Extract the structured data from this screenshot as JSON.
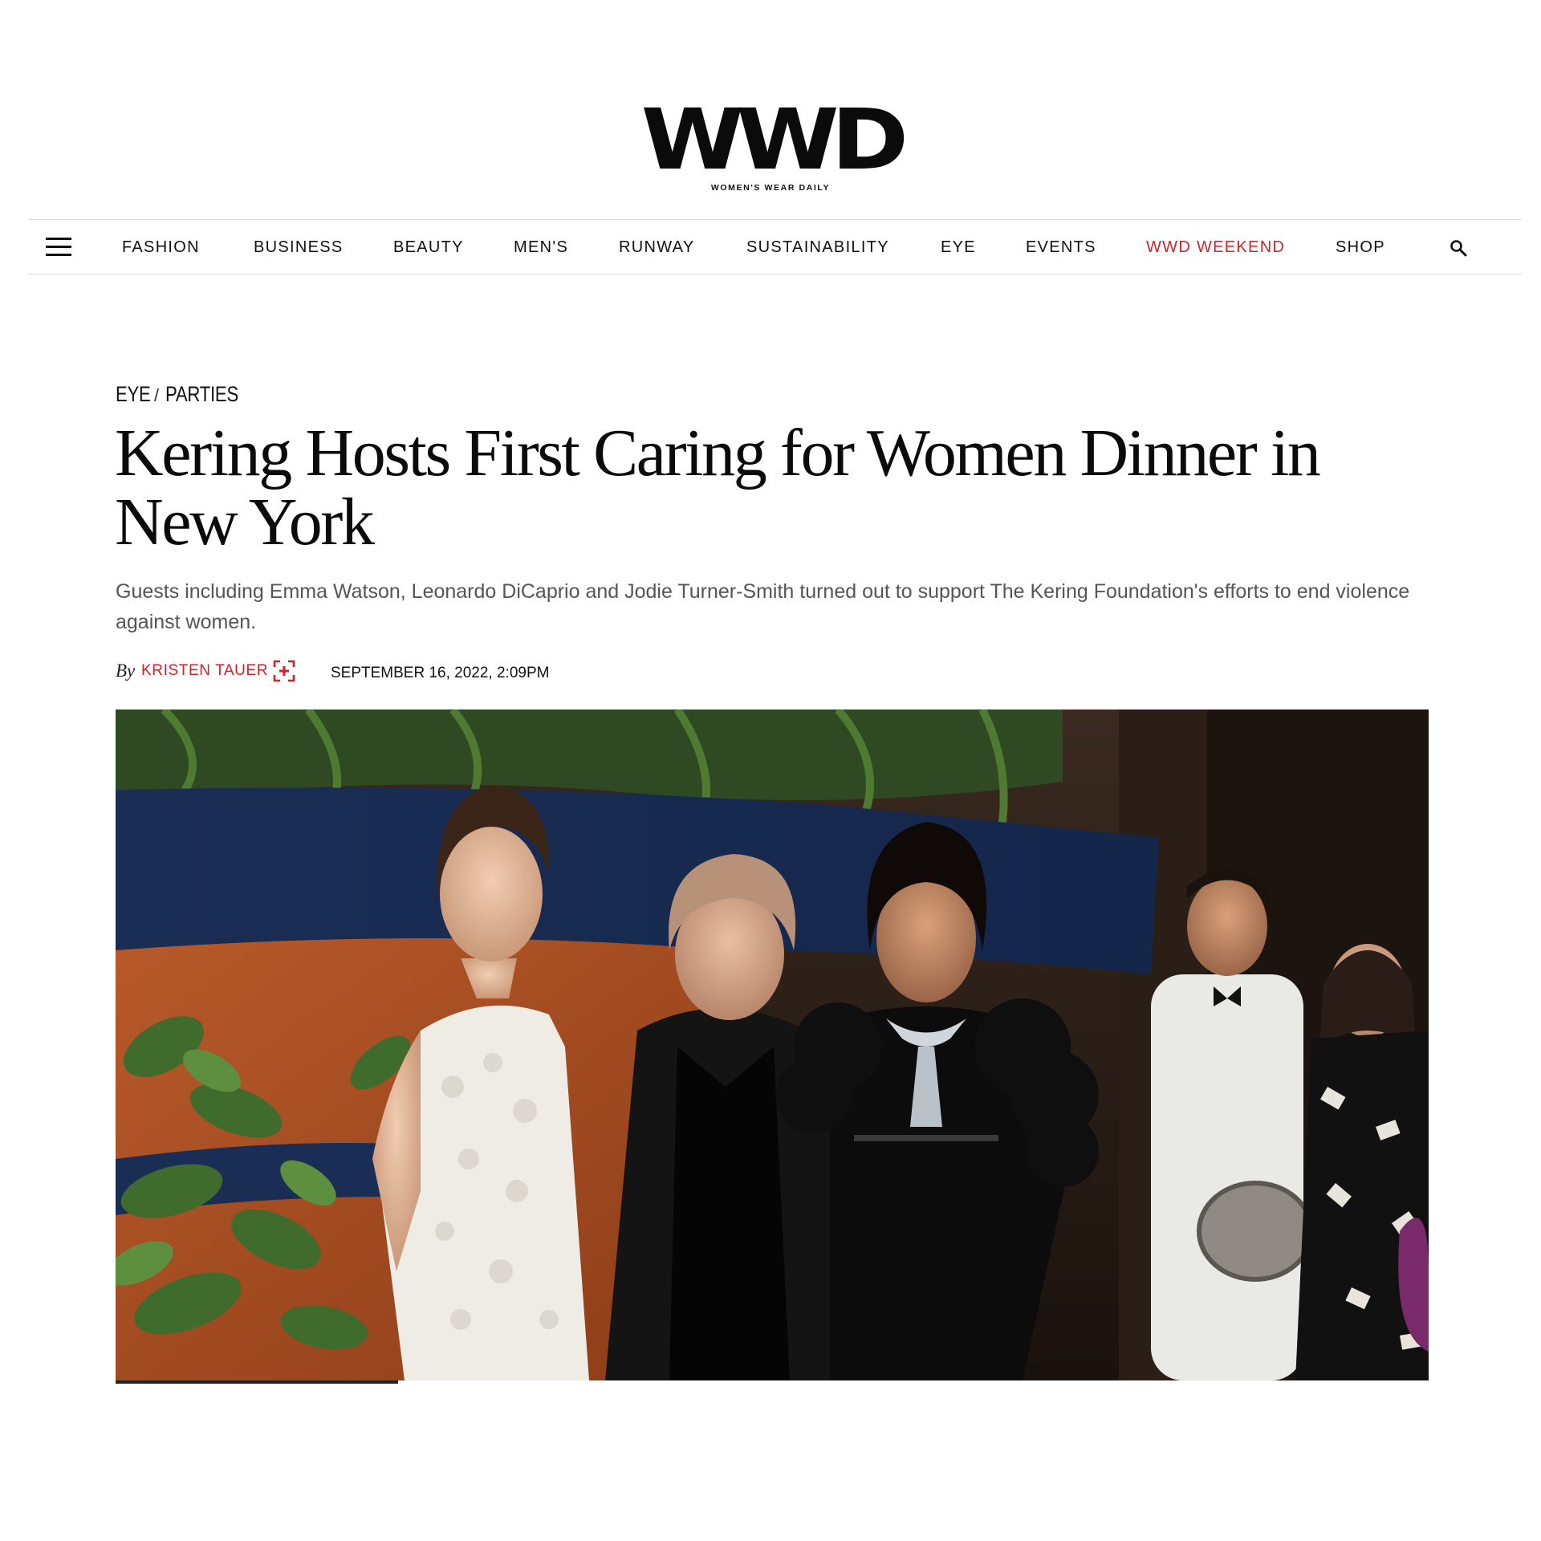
{
  "masthead": {
    "logo_word": "WWD",
    "logo_tagline": "WOMEN'S WEAR DAILY"
  },
  "nav": {
    "menu_icon": "hamburger-menu-icon",
    "items": [
      {
        "label": "FASHION"
      },
      {
        "label": "BUSINESS"
      },
      {
        "label": "BEAUTY"
      },
      {
        "label": "MEN'S"
      },
      {
        "label": "RUNWAY"
      },
      {
        "label": "SUSTAINABILITY"
      },
      {
        "label": "EYE"
      },
      {
        "label": "EVENTS"
      },
      {
        "label": "WWD WEEKEND",
        "color": "#d3222a"
      },
      {
        "label": "SHOP"
      }
    ],
    "search_icon": "search-icon"
  },
  "article": {
    "breadcrumb": [
      "EYE",
      "PARTIES"
    ],
    "breadcrumb_separator": "/",
    "headline": "Kering Hosts First Caring for Women Dinner in New York",
    "dek": "Guests including Emma Watson, Leonardo DiCaprio and Jodie Turner-Smith turned out to support The Kering Foundation's efforts to end violence against women.",
    "byline_prefix": "By",
    "author": "KRISTEN TAUER",
    "follow_icon": "follow-author-plus-icon",
    "date": "SEPTEMBER 16, 2022, 2:09PM",
    "image_progress_fraction": 0.215
  },
  "colors": {
    "accent_red": "#d3222a",
    "text": "#111111",
    "dek_gray": "#555555",
    "divider": "#dcdcdc"
  }
}
